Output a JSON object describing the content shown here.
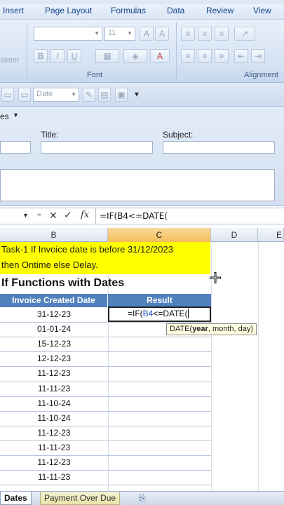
{
  "menu": [
    "Insert",
    "Page Layout",
    "Formulas",
    "Data",
    "Review",
    "View"
  ],
  "ribbon": {
    "font_size": "11",
    "font_group_label": "Font",
    "alignment_group_label": "Alignment",
    "painter_label": "ainter"
  },
  "quick_toolbar": {
    "format_combo": "Date"
  },
  "doc_panel": {
    "properties_label": "es",
    "title_label": "Title:",
    "subject_label": "Subject:"
  },
  "formula_bar": {
    "fx_label": "fx",
    "formula": "=IF(B4<=DATE("
  },
  "columns": [
    "B",
    "C",
    "D",
    "E"
  ],
  "sheet": {
    "task_line1": "Task-1 If Invoice date is before 31/12/2023",
    "task_line2": "then Ontime else Delay.",
    "table_title": "If Functions with Dates",
    "headers": [
      "Invoice Created Date",
      "Result"
    ],
    "dates": [
      "31-12-23",
      "01-01-24",
      "15-12-23",
      "12-12-23",
      "11-12-23",
      "11-11-23",
      "11-10-24",
      "11-10-24",
      "11-12-23",
      "11-11-23",
      "11-12-23",
      "11-11-23"
    ],
    "active_formula_prefix": "=IF(",
    "active_formula_ref": "B4",
    "active_formula_suffix": "<=DATE(",
    "tooltip_func": "DATE(",
    "tooltip_arg": "year",
    "tooltip_rest": ", month, day)"
  },
  "sheet_tabs": [
    "Dates",
    "Payment Over Due"
  ],
  "colors": {
    "accent": "#4f81bd",
    "highlight": "#ffff00",
    "selected_col": "#f3bd5a"
  }
}
